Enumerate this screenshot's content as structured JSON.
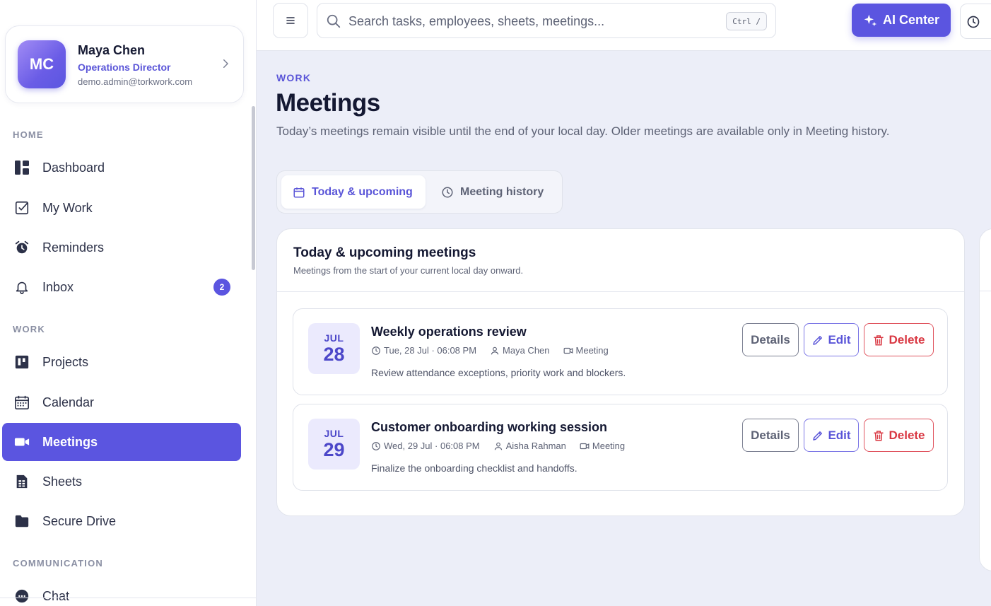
{
  "profile": {
    "initials": "MC",
    "name": "Maya Chen",
    "role": "Operations Director",
    "email": "demo.admin@torkwork.com"
  },
  "sidebar": {
    "sections": [
      "HOME",
      "WORK",
      "COMMUNICATION"
    ],
    "items": [
      {
        "label": "Dashboard",
        "icon": "dashboard-icon"
      },
      {
        "label": "My Work",
        "icon": "checkbox-icon"
      },
      {
        "label": "Reminders",
        "icon": "alarm-clock-icon"
      },
      {
        "label": "Inbox",
        "icon": "bell-icon",
        "badge": "2"
      },
      {
        "label": "Projects",
        "icon": "kanban-icon"
      },
      {
        "label": "Calendar",
        "icon": "calendar-icon"
      },
      {
        "label": "Meetings",
        "icon": "video-camera-icon",
        "active": true
      },
      {
        "label": "Sheets",
        "icon": "spreadsheet-icon"
      },
      {
        "label": "Secure Drive",
        "icon": "folder-icon"
      },
      {
        "label": "Chat",
        "icon": "chat-icon"
      }
    ]
  },
  "topbar": {
    "search_placeholder": "Search tasks, employees, sheets, meetings...",
    "shortcut": "Ctrl /",
    "ai_label": "AI Center"
  },
  "page": {
    "eyebrow": "WORK",
    "title": "Meetings",
    "description": "Today’s meetings remain visible until the end of your local day. Older meetings are available only in Meeting history."
  },
  "tabs": [
    {
      "label": "Today & upcoming",
      "active": true
    },
    {
      "label": "Meeting history",
      "active": false
    }
  ],
  "panel": {
    "title": "Today & upcoming meetings",
    "subtitle": "Meetings from the start of your current local day onward."
  },
  "meetings": [
    {
      "month": "JUL",
      "day": "28",
      "title": "Weekly operations review",
      "when": "Tue, 28 Jul · 06:08 PM",
      "owner": "Maya Chen",
      "type": "Meeting",
      "description": "Review attendance exceptions, priority work and blockers."
    },
    {
      "month": "JUL",
      "day": "29",
      "title": "Customer onboarding working session",
      "when": "Wed, 29 Jul · 06:08 PM",
      "owner": "Aisha Rahman",
      "type": "Meeting",
      "description": "Finalize the onboarding checklist and handoffs."
    }
  ],
  "actions": {
    "details": "Details",
    "edit": "Edit",
    "delete": "Delete"
  },
  "colors": {
    "accent": "#5b55e0",
    "danger": "#d93843",
    "background": "#eceef8"
  }
}
